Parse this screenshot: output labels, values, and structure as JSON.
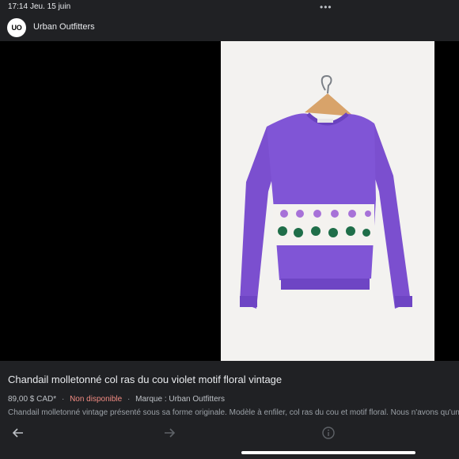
{
  "status_bar": {
    "time": "17:14",
    "date": "Jeu. 15 juin",
    "more_icon": "ellipsis-icon"
  },
  "source": {
    "logo_text": "UO",
    "name": "Urban Outfitters"
  },
  "product": {
    "title": "Chandail molletonné col ras du cou violet motif floral vintage",
    "price": "89,00 $ CAD*",
    "separator": "·",
    "availability": "Non disponible",
    "brand": "Marque : Urban Outfitters",
    "description": "Chandail molletonné vintage présenté sous sa forme originale. Modèle à enfiler, col ras du cou et motif floral. Nous n'avons qu'un"
  },
  "nav": {
    "back_icon": "arrow-left-icon",
    "forward_icon": "arrow-right-icon",
    "info_icon": "info-icon"
  },
  "colors": {
    "background": "#202124",
    "availability": "#f28b82",
    "sweater": "#7b4fcf"
  }
}
